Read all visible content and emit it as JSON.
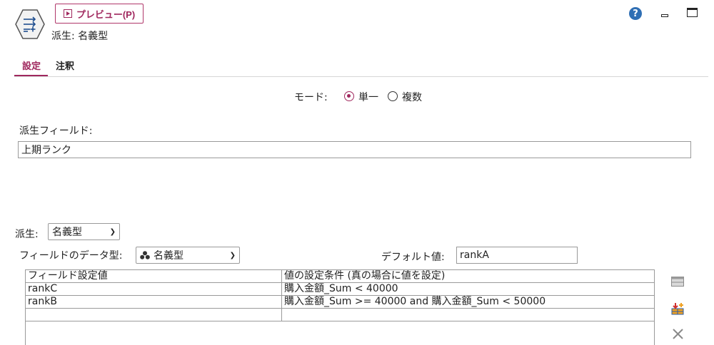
{
  "header": {
    "preview_label": "プレビュー(P)",
    "node_title": "派生: 名義型",
    "help_glyph": "?"
  },
  "tabs": [
    {
      "label": "設定",
      "active": true
    },
    {
      "label": "注釈",
      "active": false
    }
  ],
  "mode": {
    "label": "モード:",
    "options": [
      {
        "label": "単一",
        "selected": true
      },
      {
        "label": "複数",
        "selected": false
      }
    ]
  },
  "derive_field": {
    "label": "派生フィールド:",
    "value": "上期ランク"
  },
  "derive_as": {
    "label": "派生:",
    "value": "名義型"
  },
  "field_type": {
    "label": "フィールドのデータ型:",
    "value": "名義型",
    "icon": "nominal-type-icon"
  },
  "default_value": {
    "label": "デフォルト値:",
    "value": "rankA"
  },
  "table": {
    "columns": [
      "フィールド設定値",
      "値の設定条件 (真の場合に値を設定)"
    ],
    "rows": [
      [
        "rankC",
        "購入金額_Sum < 40000"
      ],
      [
        "rankB",
        "購入金額_Sum >= 40000 and 購入金額_Sum < 50000"
      ],
      [
        "",
        ""
      ]
    ]
  },
  "colors": {
    "accent": "#a0285e",
    "help": "#2f6fb4",
    "border": "#9a9a9a"
  }
}
